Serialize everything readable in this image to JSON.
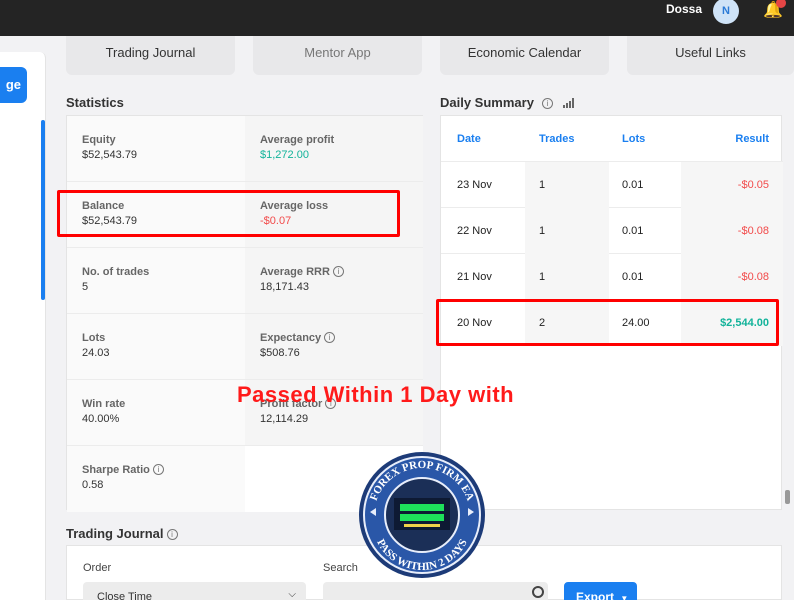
{
  "topbar": {
    "username": "Dossa",
    "avatar_initial": "N",
    "bell_icon": "bell-icon"
  },
  "sidebar": {
    "button_fragment": "ge"
  },
  "tabs": [
    "Trading Journal",
    "Mentor App",
    "Economic Calendar",
    "Useful Links"
  ],
  "statistics": {
    "title": "Statistics",
    "items": [
      {
        "label": "Equity",
        "value": "$52,543.79"
      },
      {
        "label": "Average profit",
        "value": "$1,272.00"
      },
      {
        "label": "Balance",
        "value": "$52,543.79"
      },
      {
        "label": "Average loss",
        "value": "-$0.07"
      },
      {
        "label": "No. of trades",
        "value": "5"
      },
      {
        "label": "Average RRR",
        "value": "18,171.43"
      },
      {
        "label": "Lots",
        "value": "24.03"
      },
      {
        "label": "Expectancy",
        "value": "$508.76"
      },
      {
        "label": "Win rate",
        "value": "40.00%"
      },
      {
        "label": "Profit factor",
        "value": "12,114.29"
      },
      {
        "label": "Sharpe Ratio",
        "value": "0.58"
      }
    ]
  },
  "daily_summary": {
    "title": "Daily Summary",
    "columns": [
      "Date",
      "Trades",
      "Lots",
      "Result"
    ],
    "rows": [
      [
        "23 Nov",
        "1",
        "0.01",
        "-$0.05"
      ],
      [
        "22 Nov",
        "1",
        "0.01",
        "-$0.08"
      ],
      [
        "21 Nov",
        "1",
        "0.01",
        "-$0.08"
      ],
      [
        "20 Nov",
        "2",
        "24.00",
        "$2,544.00"
      ]
    ]
  },
  "trading_journal": {
    "title": "Trading Journal",
    "order_label": "Order",
    "order_value": "Close Time",
    "search_label": "Search",
    "export_label": "Export"
  },
  "overlay": {
    "text": "Passed Within 1 Day with"
  },
  "seal": {
    "outer_top": "FOREX PROP FIRM EA",
    "outer_bottom": "PASS WITHIN 2 DAYS"
  },
  "colors": {
    "accent": "#1a7ff0",
    "positive": "#12b39a",
    "negative": "#f24a4a",
    "highlight": "#ff0000"
  }
}
